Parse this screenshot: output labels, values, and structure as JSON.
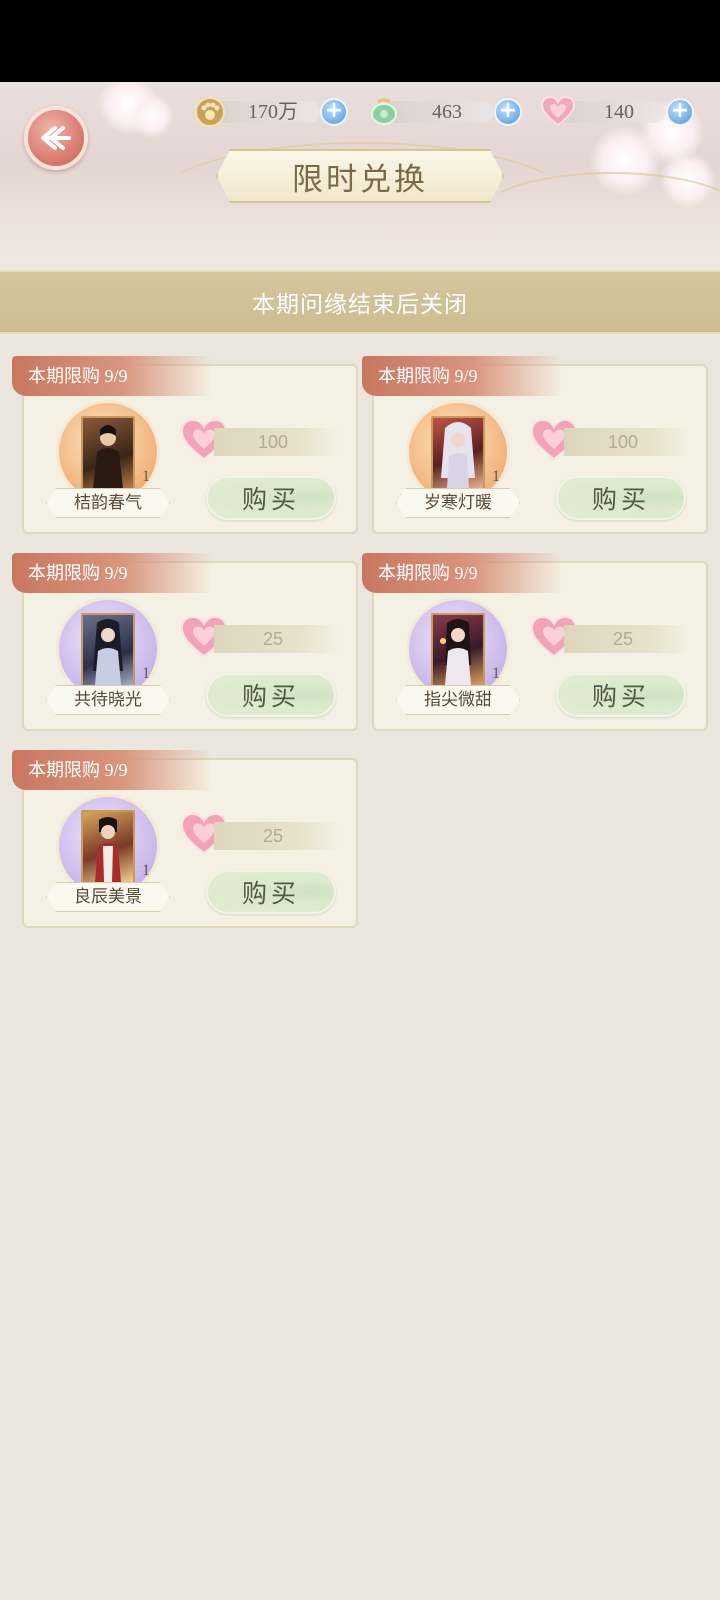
{
  "currencies": [
    {
      "icon": "paw-coin-icon",
      "value": "170万"
    },
    {
      "icon": "jade-icon",
      "value": "463"
    },
    {
      "icon": "heart-icon",
      "value": "140"
    }
  ],
  "title": "限时兑换",
  "banner": "本期问缘结束后关闭",
  "items": [
    {
      "limit": "本期限购 9/9",
      "name": "桔韵春气",
      "qty": "1",
      "price": "100",
      "buy": "购买",
      "bg": "orange"
    },
    {
      "limit": "本期限购 9/9",
      "name": "岁寒灯暖",
      "qty": "1",
      "price": "100",
      "buy": "购买",
      "bg": "orange"
    },
    {
      "limit": "本期限购 9/9",
      "name": "共待晓光",
      "qty": "1",
      "price": "25",
      "buy": "购买",
      "bg": "purple"
    },
    {
      "limit": "本期限购 9/9",
      "name": "指尖微甜",
      "qty": "1",
      "price": "25",
      "buy": "购买",
      "bg": "purple"
    },
    {
      "limit": "本期限购 9/9",
      "name": "良辰美景",
      "qty": "1",
      "price": "25",
      "buy": "购买",
      "bg": "purple"
    }
  ]
}
